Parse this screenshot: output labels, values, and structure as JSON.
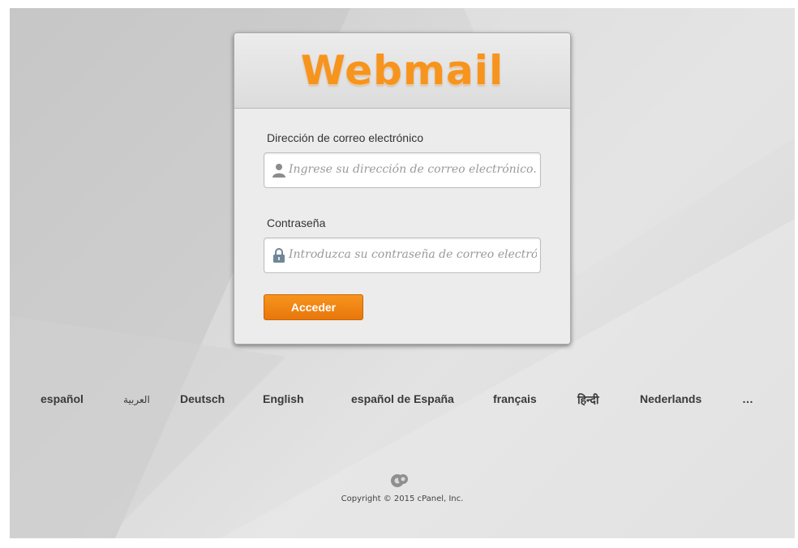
{
  "header": {
    "logo": "Webmail"
  },
  "form": {
    "email_label": "Dirección de correo electrónico",
    "email_placeholder": "Ingrese su dirección de correo electrónico.",
    "password_label": "Contraseña",
    "password_placeholder": "Introduzca su contraseña de correo electrónico.",
    "submit_label": "Acceder"
  },
  "languages": [
    "español",
    "العربية",
    "Deutsch",
    "English",
    "español de España",
    "français",
    "हिन्दी",
    "Nederlands",
    "…"
  ],
  "footer": {
    "copyright": "Copyright ©   2015 cPanel, Inc."
  },
  "colors": {
    "accent": "#f7941d",
    "card_background": "#ececec"
  },
  "icons": {
    "email_field": "user-icon",
    "password_field": "lock-icon",
    "footer": "cpanel-logo-icon"
  }
}
